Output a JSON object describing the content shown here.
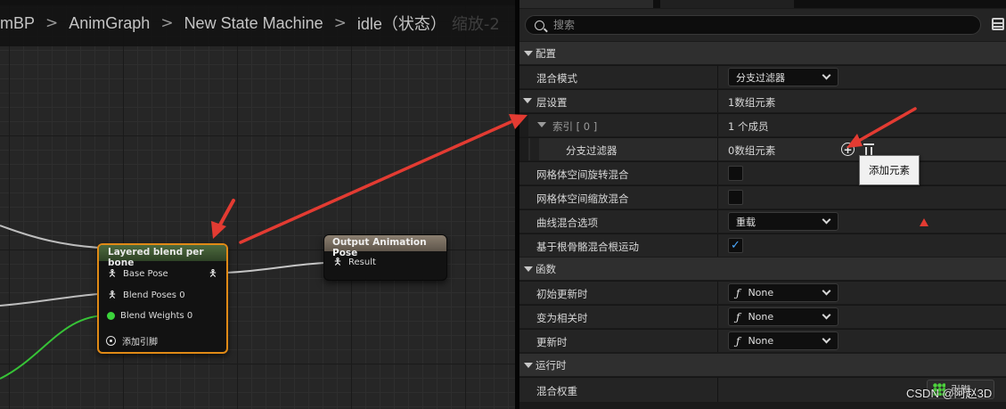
{
  "breadcrumb": {
    "items": [
      "mBP",
      "AnimGraph",
      "New State Machine",
      "idle（状态）"
    ],
    "ghost": "缩放-2"
  },
  "nodes": {
    "layered": {
      "title": "Layered blend per bone",
      "pins": [
        "Base Pose",
        "Blend Poses 0",
        "Blend Weights 0",
        "添加引脚"
      ]
    },
    "output": {
      "title": "Output Animation Pose",
      "pins": [
        "Result"
      ]
    }
  },
  "details": {
    "search_placeholder": "搜索",
    "sections": {
      "config": "配置",
      "functions": "函数",
      "runtime": "运行时"
    },
    "rows": {
      "blend_mode": {
        "label": "混合模式",
        "value": "分支过滤器"
      },
      "layer_setup": {
        "label": "层设置",
        "value": "1数组元素"
      },
      "index0": {
        "label": "索引 [ 0 ]",
        "value": "1 个成员"
      },
      "branch_filters": {
        "label": "分支过滤器",
        "value": "0数组元素"
      },
      "mesh_rot": {
        "label": "网格体空间旋转混合"
      },
      "mesh_scale": {
        "label": "网格体空间缩放混合"
      },
      "curve_blend": {
        "label": "曲线混合选项",
        "value": "重载"
      },
      "root_motion": {
        "label": "基于根骨骼混合根运动"
      },
      "initial_update": {
        "label": "初始更新时",
        "value": "None"
      },
      "become_relevant": {
        "label": "变为相关时",
        "value": "None"
      },
      "on_update": {
        "label": "更新时",
        "value": "None"
      },
      "blend_weights": {
        "label": "混合权重"
      }
    },
    "tooltip": "添加元素",
    "pin_tag": "引脚"
  },
  "watermark": "CSDN @阿赵3D",
  "colors": {
    "selection_outline": "#e08a16",
    "arrow_red": "#e33b32",
    "checkbox_blue": "#4ca8ff",
    "exec_green": "#3bd43b"
  }
}
